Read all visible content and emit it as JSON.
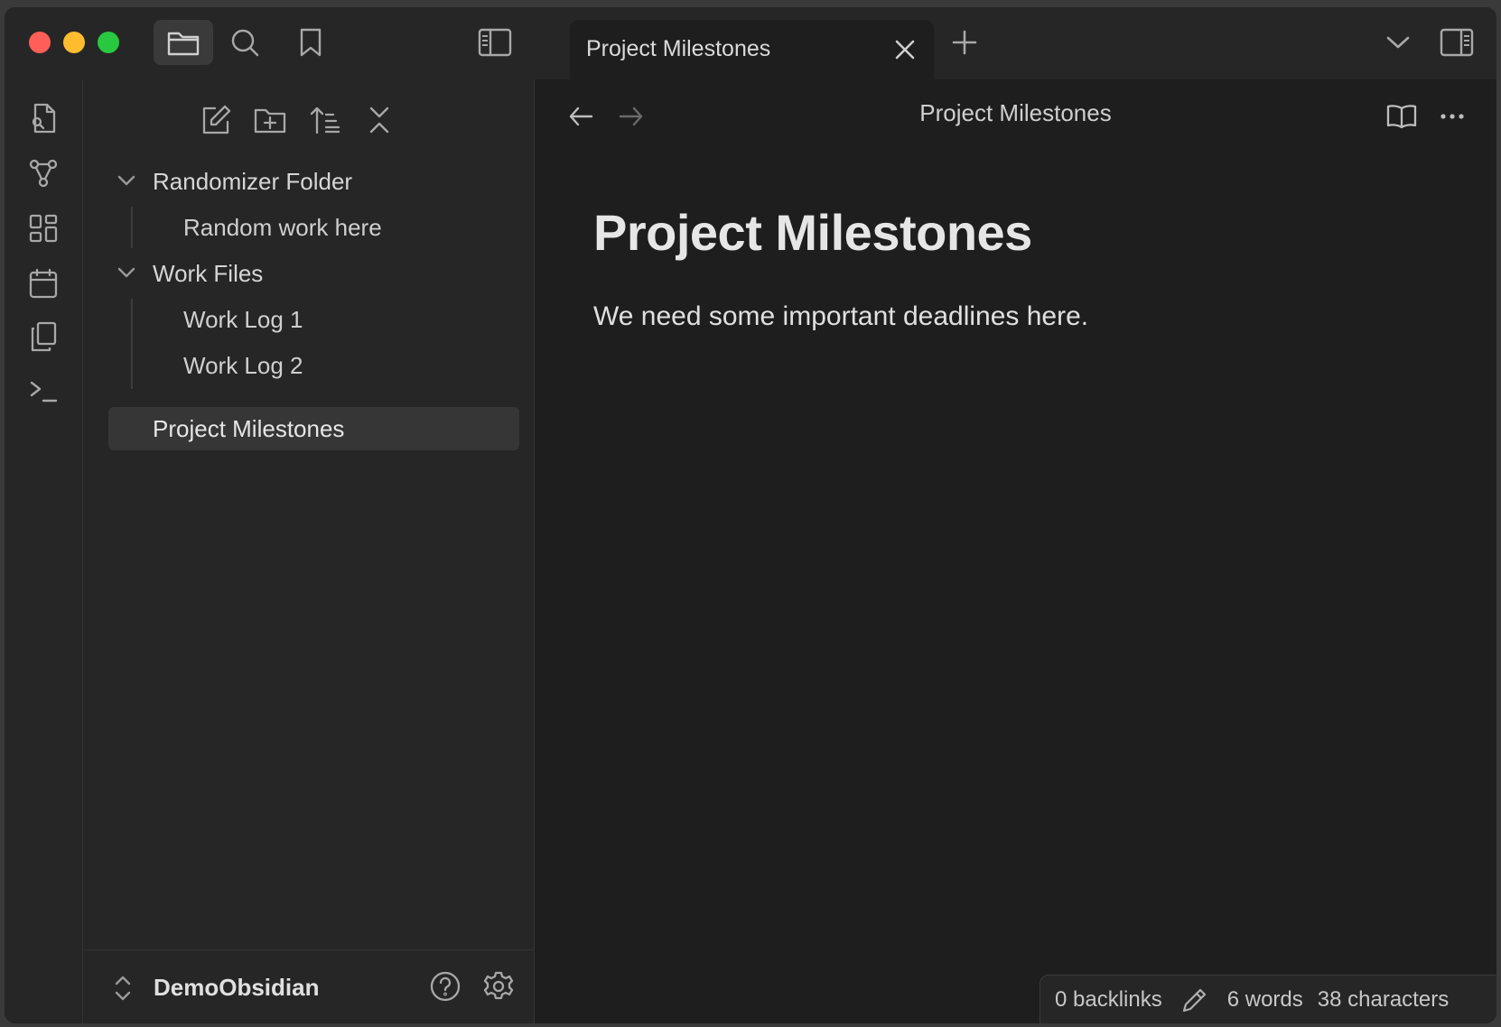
{
  "titlebar": {
    "active_tab": "Project Milestones",
    "traffic_light_colors": {
      "close": "#ff5f57",
      "minimize": "#febc2e",
      "maximize": "#28c840"
    }
  },
  "file_tree": [
    {
      "label": "Randomizer Folder",
      "children": [
        "Random work here"
      ]
    },
    {
      "label": "Work Files",
      "children": [
        "Work Log 1",
        "Work Log 2"
      ]
    }
  ],
  "file_tree_root_files": [
    "Project Milestones"
  ],
  "sidebar_footer": {
    "vault_name": "DemoObsidian"
  },
  "view_header": {
    "title": "Project Milestones"
  },
  "document": {
    "heading": "Project Milestones",
    "body": "We need some important deadlines here."
  },
  "status_bar": {
    "backlinks": "0 backlinks",
    "words": "6 words",
    "characters": "38 characters"
  },
  "icons": {
    "titlebar": [
      "folder-icon",
      "search-icon",
      "bookmark-icon",
      "sidebar-toggle-icon",
      "close-icon",
      "plus-icon",
      "chevron-down-icon",
      "right-sidebar-icon"
    ],
    "ribbon": [
      "open-quick-switcher-icon",
      "graph-view-icon",
      "canvas-icon",
      "calendar-icon",
      "templates-icon",
      "terminal-icon"
    ],
    "sidebar_tools": [
      "new-note-icon",
      "new-folder-icon",
      "sort-icon",
      "collapse-all-icon"
    ],
    "view": [
      "arrow-left-icon",
      "arrow-right-icon",
      "reading-view-icon",
      "more-options-icon"
    ],
    "footer": [
      "vault-switch-icon",
      "help-icon",
      "settings-icon",
      "pencil-icon"
    ]
  }
}
